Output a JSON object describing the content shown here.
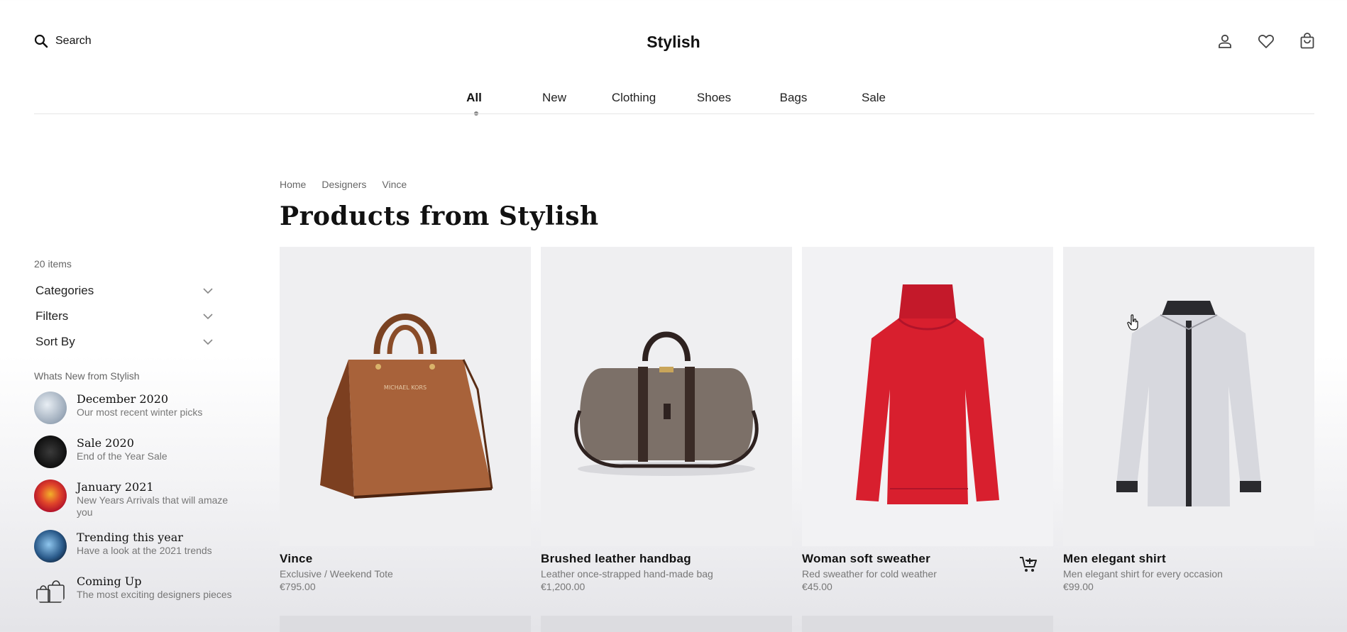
{
  "header": {
    "search_label": "Search",
    "logo": "Stylish",
    "icons": [
      "user-icon",
      "heart-icon",
      "shopping-bag-icon"
    ]
  },
  "nav": {
    "items": [
      {
        "label": "All",
        "active": true
      },
      {
        "label": "New"
      },
      {
        "label": "Clothing"
      },
      {
        "label": "Shoes"
      },
      {
        "label": "Bags"
      },
      {
        "label": "Sale"
      }
    ]
  },
  "breadcrumb": [
    "Home",
    "Designers",
    "Vince"
  ],
  "page_title": "Products from Stylish",
  "sidebar": {
    "item_count": "20 items",
    "accordion": [
      "Categories",
      "Filters",
      "Sort By"
    ],
    "whats_new_heading": "Whats New from Stylish",
    "news": [
      {
        "title": "December 2020",
        "subtitle": "Our most recent winter picks"
      },
      {
        "title": "Sale 2020",
        "subtitle": "End of the Year Sale"
      },
      {
        "title": "January 2021",
        "subtitle": "New Years Arrivals that will amaze you"
      },
      {
        "title": "Trending this year",
        "subtitle": "Have a look at the 2021 trends"
      },
      {
        "title": "Coming Up",
        "subtitle": "The most exciting designers pieces"
      }
    ]
  },
  "products": [
    {
      "name": "Vince",
      "desc": "Exclusive / Weekend Tote",
      "price": "€795.00"
    },
    {
      "name": "Brushed leather handbag",
      "desc": "Leather once-strapped hand-made bag",
      "price": "€1,200.00"
    },
    {
      "name": "Woman soft sweather",
      "desc": "Red sweather for cold weather",
      "price": "€45.00"
    },
    {
      "name": "Men elegant shirt",
      "desc": "Men elegant shirt for every occasion",
      "price": "€99.00"
    }
  ],
  "colors": {
    "accent": "#111111",
    "muted_text": "#777777",
    "card_bg": "#efeff1",
    "handbag_brown": "#a8623a",
    "sweater_red": "#d81f2e"
  }
}
